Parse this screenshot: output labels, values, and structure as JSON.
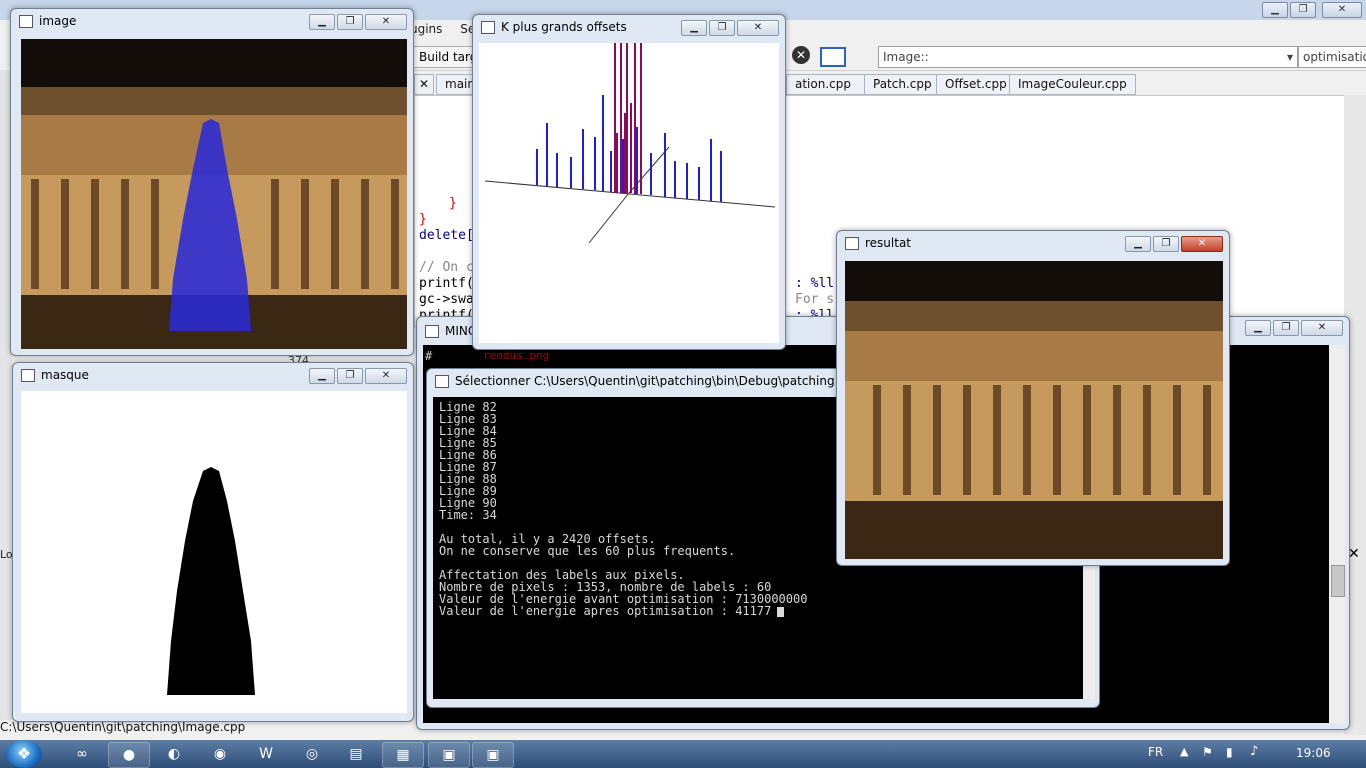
{
  "ide": {
    "menu": [
      "ugins",
      "Se"
    ],
    "toolbar": {
      "build_target": "Build targe",
      "scope_combo": "Image::",
      "function_combo": "optimisationC"
    },
    "tabs": [
      "main.",
      "ation.cpp",
      "Patch.cpp",
      "Offset.cpp",
      "ImageCouleur.cpp"
    ],
    "code_lines": [
      "}",
      "}",
      "delete[",
      "// On c",
      "printf(",
      "gc->swa",
      "printf("
    ],
    "code_right": [
      ": %ll",
      "For s",
      ": %ll"
    ],
    "line_number": "374",
    "output_filename": "rendus.png",
    "status_path": "C:\\Users\\Quentin\\git\\patching\\Image.cpp"
  },
  "windows": {
    "image": {
      "title": "image"
    },
    "masque": {
      "title": "masque"
    },
    "offsets": {
      "title": "K plus grands offsets"
    },
    "resultat": {
      "title": "resultat"
    },
    "mingw": {
      "title": "MINC"
    },
    "console": {
      "title": "Sélectionner C:\\Users\\Quentin\\git\\patching\\bin\\Debug\\patching.exe",
      "lines": [
        "Ligne 82",
        "Ligne 83",
        "Ligne 84",
        "Ligne 85",
        "Ligne 86",
        "Ligne 87",
        "Ligne 88",
        "Ligne 89",
        "Ligne 90",
        "Time: 34",
        "",
        "Au total, il y a 2420 offsets.",
        "On ne conserve que les 60 plus frequents.",
        "",
        "Affectation des labels aux pixels.",
        "Nombre de pixels : 1353, nombre de labels : 60",
        "Valeur de l'energie avant optimisation : 7130000000",
        "Valeur de l'energie apres optimisation : 41177"
      ]
    }
  },
  "taskbar": {
    "language": "FR",
    "clock": "19:06",
    "apps": [
      "ie-icon",
      "tomato-icon",
      "eclipse-icon",
      "opera-icon",
      "word-icon",
      "chrome-icon",
      "explorer-icon",
      "codeblocks-icon",
      "window-icon",
      "window-icon"
    ]
  },
  "colors": {
    "accent_blue": "#1f1fd8",
    "console_bg": "#000000",
    "window_frame": "#dfe8f3"
  }
}
